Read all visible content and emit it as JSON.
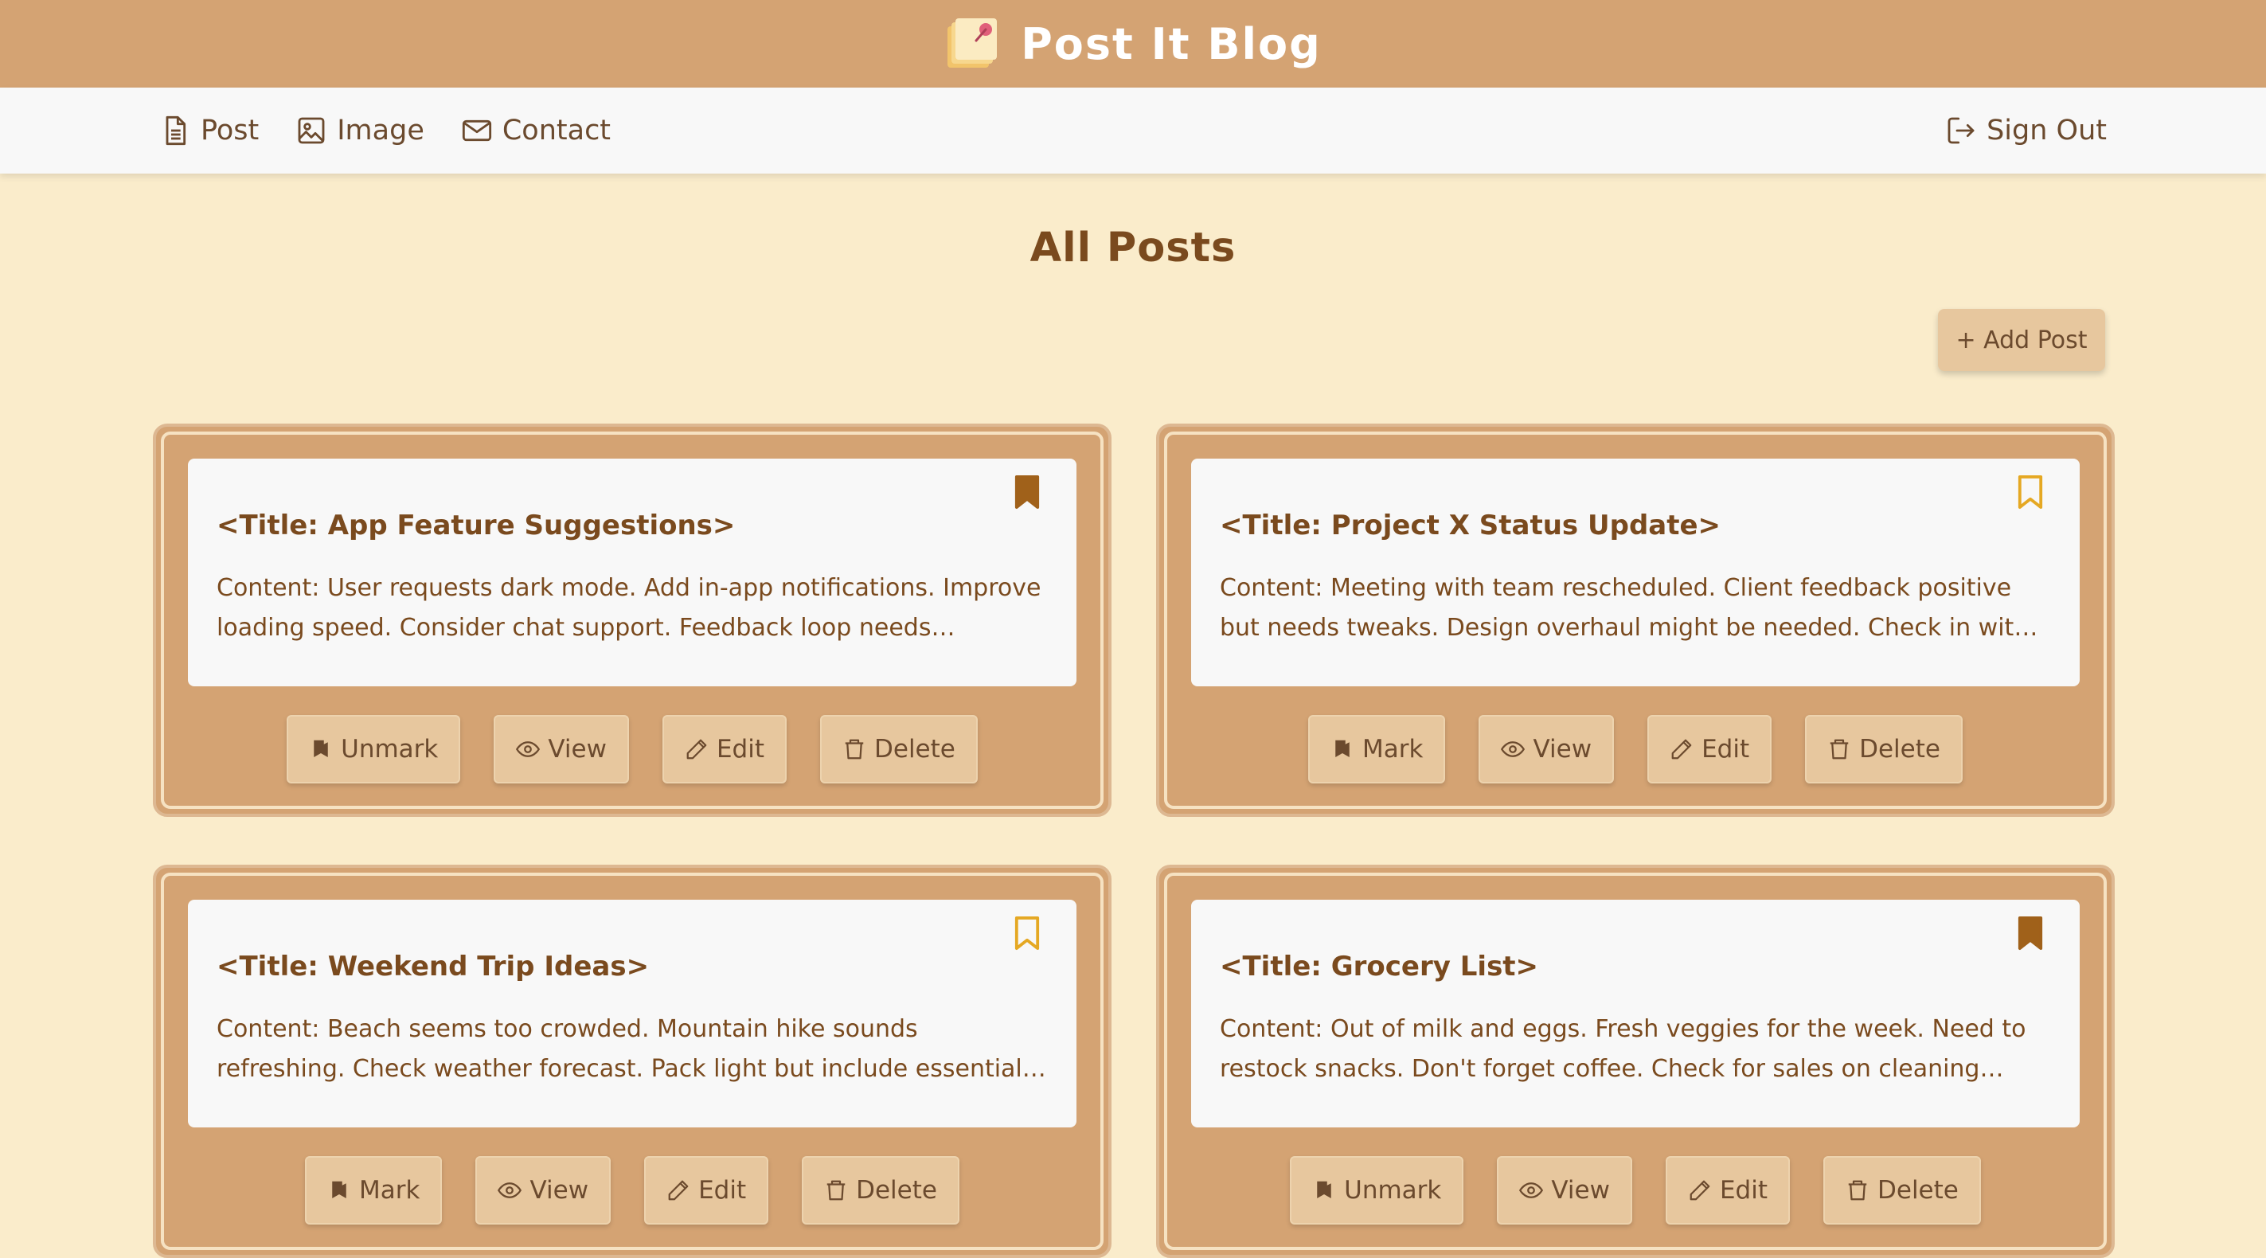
{
  "header": {
    "brand": "Post It Blog"
  },
  "nav": {
    "post": "Post",
    "image": "Image",
    "contact": "Contact",
    "sign_out": "Sign Out"
  },
  "page": {
    "title": "All Posts",
    "add_post": "+ Add Post"
  },
  "colors": {
    "header_bg": "#D4A373",
    "page_bg": "#FAECCB",
    "card_bg": "#D4A373",
    "button_bg": "#E7C79E",
    "bookmark_filled": "#A0611A",
    "bookmark_outline": "#E5A823"
  },
  "posts": [
    {
      "title": "<Title: App Feature Suggestions>",
      "content": "Content: User requests dark mode. Add in-app notifications. Improve loading speed. Consider chat support. Feedback loop needs tightening.",
      "bookmarked": true,
      "mark_label": "Unmark",
      "view_label": "View",
      "edit_label": "Edit",
      "delete_label": "Delete"
    },
    {
      "title": "<Title: Project X Status Update>",
      "content": "Content: Meeting with team rescheduled. Client feedback positive but needs tweaks. Design overhaul might be needed. Check in with Dev…",
      "bookmarked": false,
      "mark_label": "Mark",
      "view_label": "View",
      "edit_label": "Edit",
      "delete_label": "Delete"
    },
    {
      "title": "<Title: Weekend Trip Ideas>",
      "content": "Content: Beach seems too crowded. Mountain hike sounds refreshing. Check weather forecast. Pack light but include essentials. Call ahead…",
      "bookmarked": false,
      "mark_label": "Mark",
      "view_label": "View",
      "edit_label": "Edit",
      "delete_label": "Delete"
    },
    {
      "title": "<Title: Grocery List>",
      "content": "Content: Out of milk and eggs. Fresh veggies for the week. Need to restock snacks. Don't forget coffee. Check for sales on cleaning…",
      "bookmarked": true,
      "mark_label": "Unmark",
      "view_label": "View",
      "edit_label": "Edit",
      "delete_label": "Delete"
    }
  ]
}
